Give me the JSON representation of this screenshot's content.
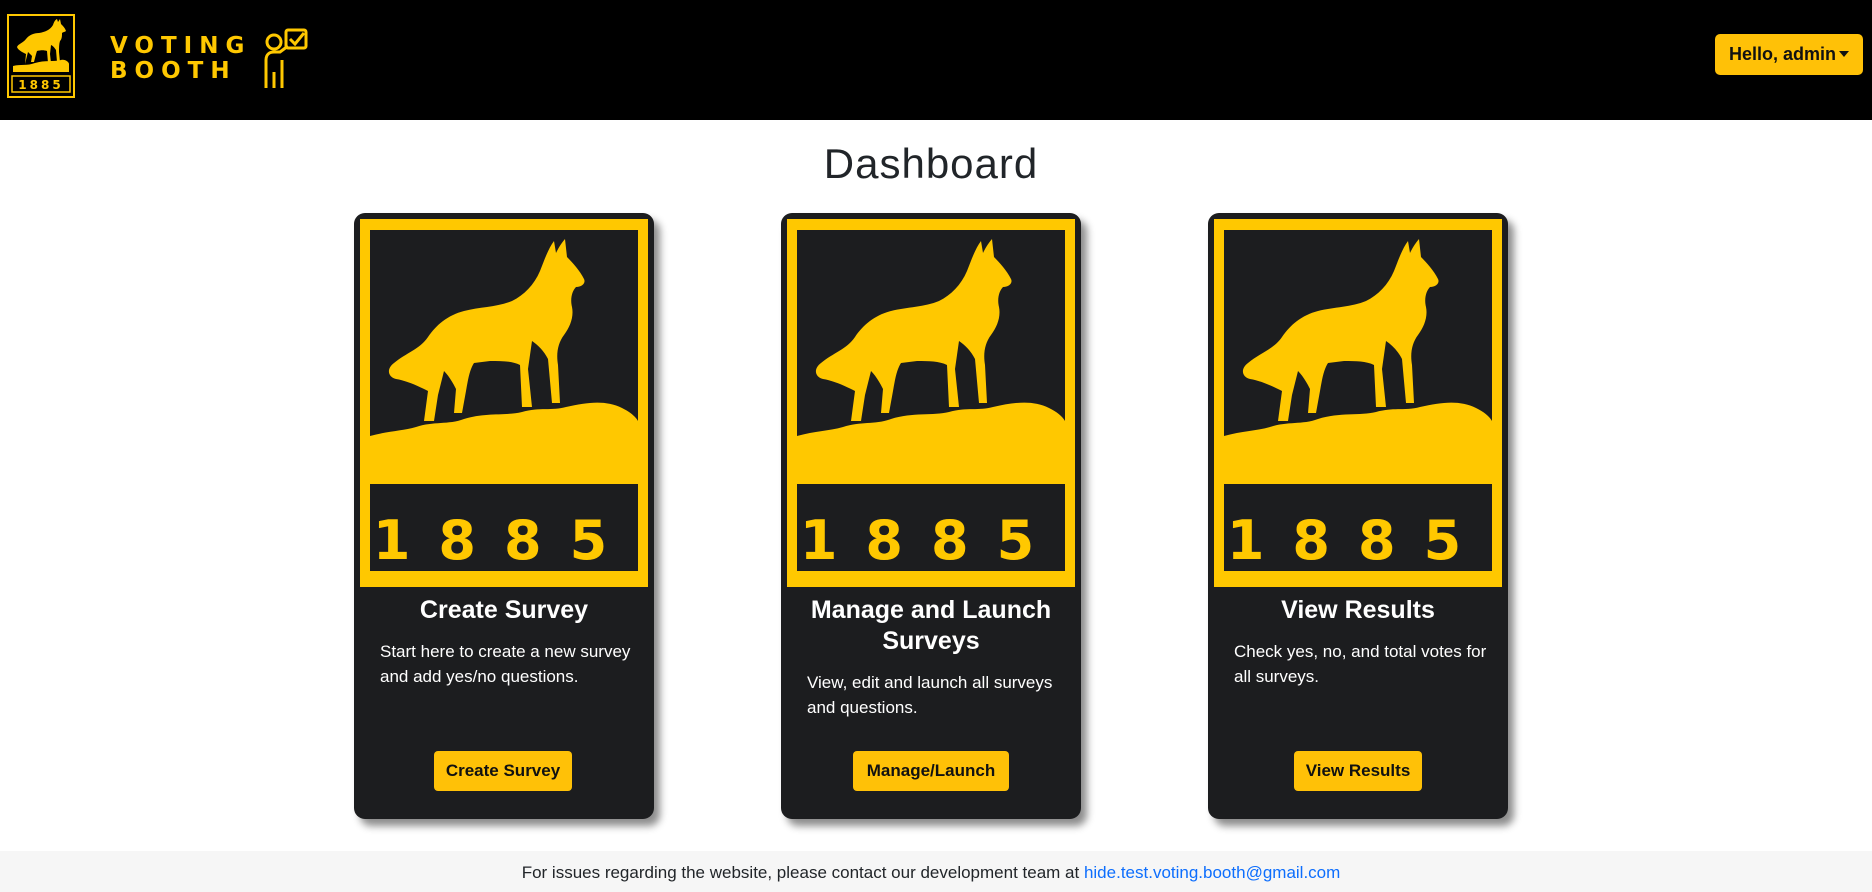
{
  "navbar": {
    "logo_badge_year": "1885",
    "brand_line_1": "VOTING",
    "brand_line_2": "BOOTH",
    "user_menu_label": "Hello, admin",
    "brand_color": "#ffc800",
    "background": "#000000"
  },
  "main": {
    "title": "Dashboard",
    "cards": [
      {
        "image_year": "1885",
        "title": "Create Survey",
        "text": "Start here to create a new survey and add yes/no questions.",
        "button_label": "Create Survey"
      },
      {
        "image_year": "1885",
        "title": "Manage and Launch Surveys",
        "text": "View, edit and launch all surveys and questions.",
        "button_label": "Manage/Launch"
      },
      {
        "image_year": "1885",
        "title": "View Results",
        "text": "Check yes, no, and total votes for all surveys.",
        "button_label": "View Results"
      }
    ]
  },
  "footer": {
    "text": "For issues regarding the website, please contact our development team at",
    "email": "hide.test.voting.booth@gmail.com"
  },
  "colors": {
    "accent": "#ffc107",
    "card_background": "#1c1d1f",
    "link": "#0d6efd"
  }
}
